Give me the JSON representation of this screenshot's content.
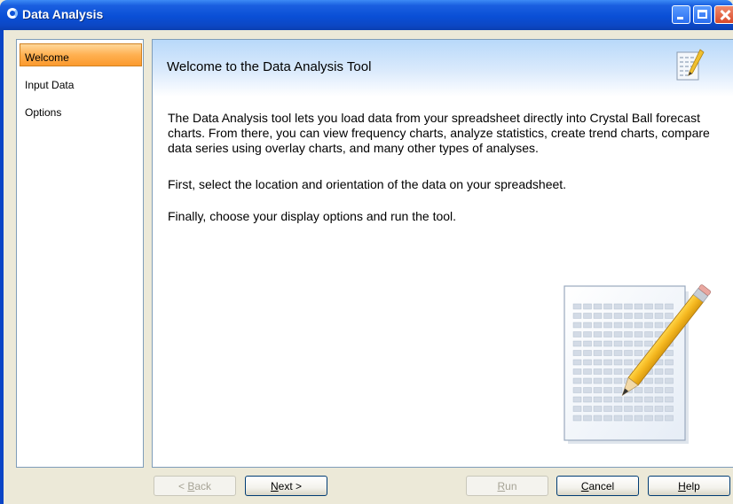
{
  "window": {
    "title": "Data Analysis"
  },
  "nav": {
    "items": [
      {
        "label": "Welcome",
        "selected": true
      },
      {
        "label": "Input Data",
        "selected": false
      },
      {
        "label": "Options",
        "selected": false
      }
    ]
  },
  "content": {
    "heading": "Welcome to the Data Analysis Tool",
    "paragraphs": [
      "The Data Analysis tool lets you load data from your spreadsheet directly into Crystal Ball forecast charts. From there, you can view frequency charts, analyze statistics, create trend charts, compare data series using overlay charts, and many other types of analyses.",
      "First, select the location and orientation of the data on your spreadsheet.",
      "Finally, choose your display options and run the tool."
    ],
    "header_icon": "spreadsheet-pencil-icon",
    "illustration": "spreadsheet-pencil-illustration"
  },
  "buttons": {
    "back": {
      "prefix": "< ",
      "key": "B",
      "rest": "ack",
      "enabled": false
    },
    "next": {
      "prefix": "",
      "key": "N",
      "rest": "ext >",
      "enabled": true
    },
    "run": {
      "prefix": "",
      "key": "R",
      "rest": "un",
      "enabled": false
    },
    "cancel": {
      "prefix": "",
      "key": "C",
      "rest": "ancel",
      "enabled": true
    },
    "help": {
      "prefix": "",
      "key": "H",
      "rest": "elp",
      "enabled": true
    }
  },
  "colors": {
    "titlebar": "#0a4fd6",
    "nav_selected": "#ffb050",
    "header_band": "#b8d9fa",
    "border": "#7f9db9"
  }
}
